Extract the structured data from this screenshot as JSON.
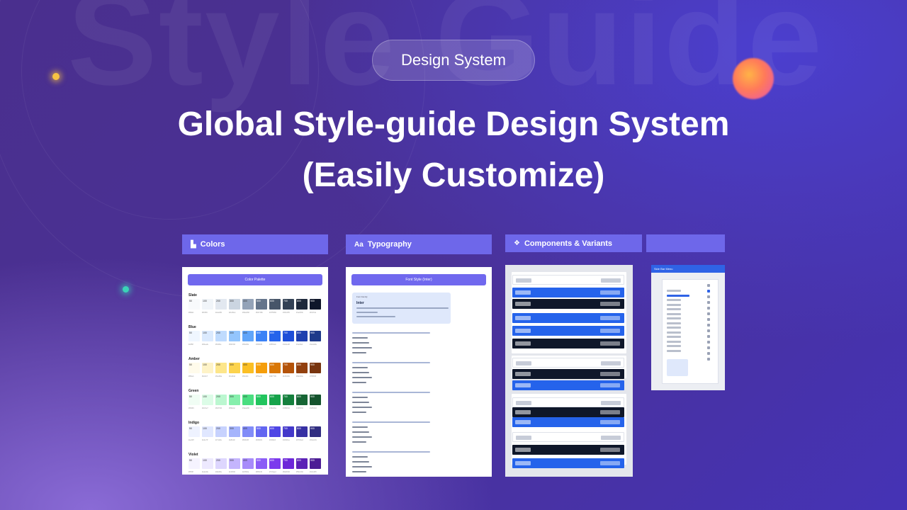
{
  "hero": {
    "badge": "Design System",
    "headline_line1": "Global Style-guide Design System",
    "headline_line2": "(Easily Customize)",
    "background_word": "Style Guide"
  },
  "panels": {
    "colors": {
      "label": "Colors",
      "icon": "palette-icon",
      "sheet_title": "Color Palette"
    },
    "typography": {
      "label": "Typography",
      "icon": "text-aa-icon",
      "icon_text": "Aa",
      "sheet_title": "Font Style (Inter)"
    },
    "components": {
      "label": "Components & Variants",
      "icon": "component-diamond-icon"
    },
    "sidebar": {
      "label": "",
      "sheet_title": "Side Bar Menu"
    }
  },
  "color_groups": [
    {
      "name": "Slate",
      "swatches": [
        "#f8fafc",
        "#f1f5f9",
        "#e2e8f0",
        "#cbd5e1",
        "#94a3b8",
        "#64748b",
        "#475569",
        "#334155",
        "#1e293b",
        "#0f172a"
      ]
    },
    {
      "name": "Blue",
      "swatches": [
        "#eff6ff",
        "#dbeafe",
        "#bfdbfe",
        "#93c5fd",
        "#60a5fa",
        "#3b82f6",
        "#2563eb",
        "#1d4ed8",
        "#1e40af",
        "#1e3a8a"
      ]
    },
    {
      "name": "Amber",
      "swatches": [
        "#fffbeb",
        "#fef3c7",
        "#fde68a",
        "#fcd34d",
        "#fbbf24",
        "#f59e0b",
        "#d97706",
        "#b45309",
        "#92400e",
        "#78350f"
      ]
    },
    {
      "name": "Green",
      "swatches": [
        "#f0fdf4",
        "#dcfce7",
        "#bbf7d0",
        "#86efac",
        "#4ade80",
        "#22c55e",
        "#16a34a",
        "#15803d",
        "#166534",
        "#14532d"
      ]
    },
    {
      "name": "Indigo",
      "swatches": [
        "#eef2ff",
        "#e0e7ff",
        "#c7d2fe",
        "#a5b4fc",
        "#818cf8",
        "#6366f1",
        "#4f46e5",
        "#4338ca",
        "#3730a3",
        "#312e81"
      ]
    },
    {
      "name": "Violet",
      "swatches": [
        "#f5f3ff",
        "#ede9fe",
        "#ddd6fe",
        "#c4b5fd",
        "#a78bfa",
        "#8b5cf6",
        "#7c3aed",
        "#6d28d9",
        "#5b21b6",
        "#4c1d95"
      ]
    }
  ],
  "swatch_steps": [
    "50",
    "100",
    "200",
    "300",
    "400",
    "500",
    "600",
    "700",
    "800",
    "900"
  ],
  "typography_sample": {
    "font_label": "Font Family",
    "font_name": "Inter"
  },
  "colors": {
    "accent": "#6e67ea",
    "sheet_title_bar": "#7068ee",
    "component_blue": "#2563eb",
    "component_dark": "#0f172a"
  }
}
